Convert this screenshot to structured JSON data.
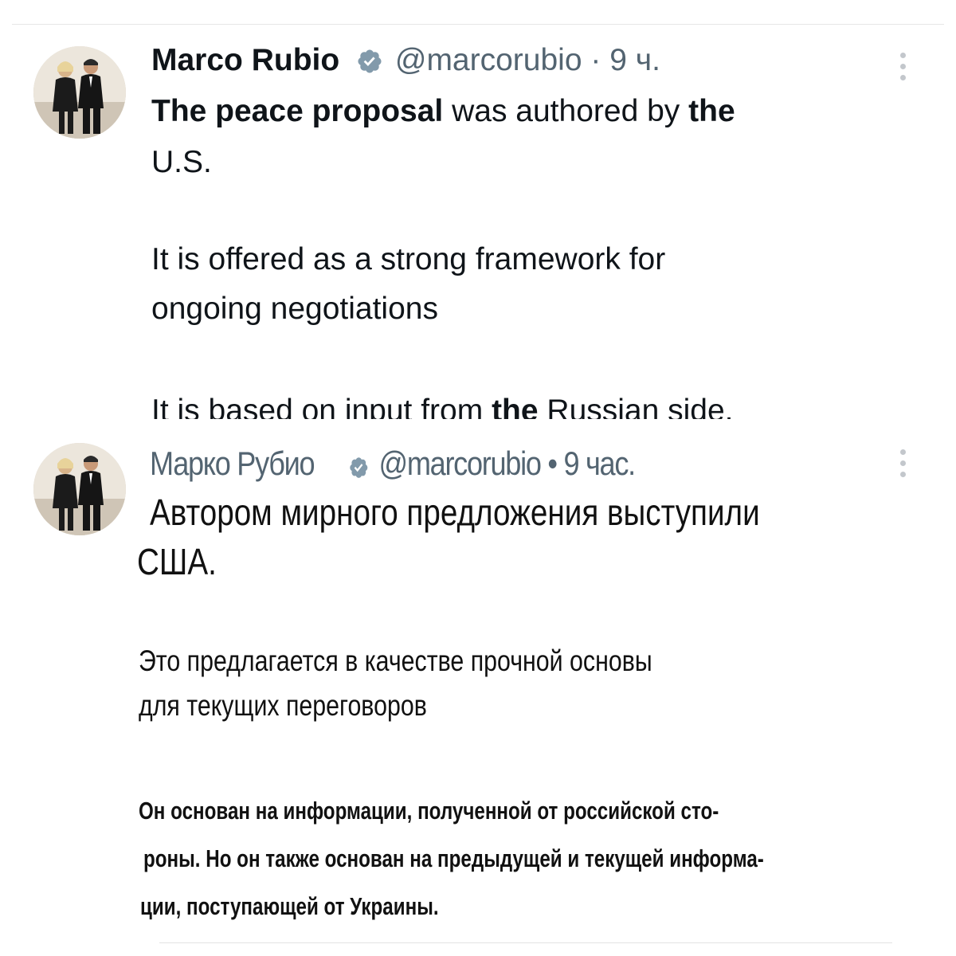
{
  "english_tweet": {
    "author_name": "Marco Rubio",
    "handle": "@marcorubio",
    "separator": "·",
    "time": "9 ч.",
    "line1_bold": "The peace proposal",
    "line1_regular": " was authored by ",
    "line1_bold2": "the",
    "line2": "U.S.",
    "line3": "It is offered as a strong framework for",
    "line4": "ongoing negotiations",
    "line5_part1": "It is based on input from ",
    "line5_bold": "the",
    "line5_part2": " Russian side."
  },
  "russian_tweet": {
    "author_name": "Марко Рубио",
    "handle": "@marcorubio",
    "separator": "•",
    "time": "9 час.",
    "title_line1": "Автором мирного предложения выступили",
    "title_line2": "США.",
    "mid_line1": "Это предлагается в качестве прочной основы",
    "mid_line2": "для текущих переговоров",
    "small_line1": "Он основан на информации, полученной от российской сто-",
    "small_line2": "роны. Но он также основан на предыдущей и текущей информа-",
    "small_line3": "ции, поступающей от Украины."
  },
  "icons": {
    "verified": "verified-badge-icon",
    "more": "more-vertical-icon"
  },
  "colors": {
    "text": "#0f1419",
    "muted": "#536471",
    "verified_badge": "#829aab"
  }
}
